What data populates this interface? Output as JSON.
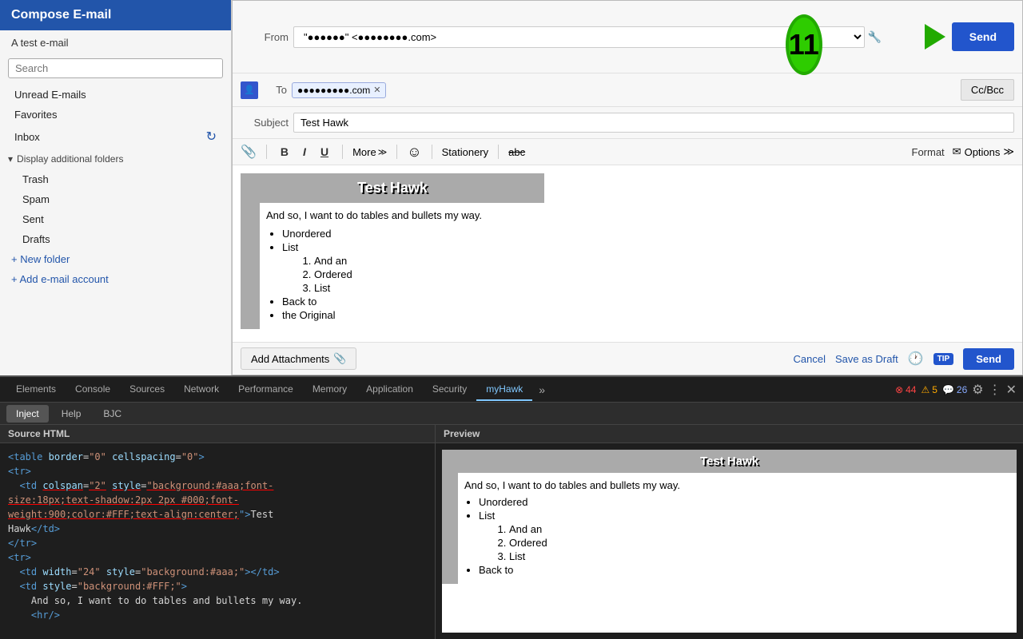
{
  "sidebar": {
    "title": "Compose E-mail",
    "subtitle": "A test e-mail",
    "subject_field_value": "Test Hawk",
    "search_placeholder": "Search",
    "nav_items": [
      {
        "label": "Unread E-mails"
      },
      {
        "label": "Favorites"
      },
      {
        "label": "Inbox"
      }
    ],
    "section_header": "Display additional folders",
    "sub_items": [
      {
        "label": "Trash"
      },
      {
        "label": "Spam"
      },
      {
        "label": "Sent"
      },
      {
        "label": "Drafts"
      }
    ],
    "add_folder": "+ New folder",
    "add_account": "+ Add e-mail account"
  },
  "compose": {
    "from_label": "From",
    "from_value": "\"●●●●●●\" <●●●●●●●●.com>",
    "to_label": "To",
    "to_value": "●●●●●●●●●.com",
    "subject_label": "Subject",
    "subject_value": "Test Hawk",
    "send_label": "Send",
    "ccbcc_label": "Cc/Bcc",
    "toolbar": {
      "bold": "B",
      "italic": "I",
      "underline": "U",
      "more": "More",
      "stationery": "Stationery",
      "format": "Format",
      "options": "Options"
    },
    "email_title": "Test Hawk",
    "email_intro": "And so, I want to do tables and bullets my way.",
    "email_bullets": [
      "Unordered",
      "List"
    ],
    "email_ordered_sub": [
      "And an",
      "Ordered",
      "List"
    ],
    "email_bullets2": [
      "Back to",
      "the Original"
    ],
    "attach_label": "Add Attachments",
    "cancel_label": "Cancel",
    "draft_label": "Save as Draft",
    "tip_label": "TIP",
    "send_footer_label": "Send"
  },
  "devtools": {
    "tabs": [
      "Elements",
      "Console",
      "Sources",
      "Network",
      "Performance",
      "Memory",
      "Application",
      "Security",
      "myHawk"
    ],
    "active_tab": "myHawk",
    "errors": "44",
    "warnings": "5",
    "messages": "26",
    "sub_tabs": [
      "Inject",
      "Help",
      "BJC"
    ],
    "active_sub_tab": "Inject",
    "source_title": "Source HTML",
    "preview_title": "Preview",
    "source_lines": [
      "<table border=\"0\" cellspacing=\"0\">",
      "<tr>",
      "  <td colspan=\"2\" style=\"background:#aaa;font-",
      "size:18px;text-shadow:2px 2px #000;font-",
      "weight:900;color:#FFF;text-align:center;\">Test",
      "Hawk</td>",
      "</tr>",
      "<tr>",
      "  <td width=\"24\" style=\"background:#aaa;\"></td>",
      "  <td style=\"background:#FFF;\">",
      "    And so, I want to do tables and bullets my way.",
      "    <hr/>"
    ],
    "badge_number": "11"
  }
}
